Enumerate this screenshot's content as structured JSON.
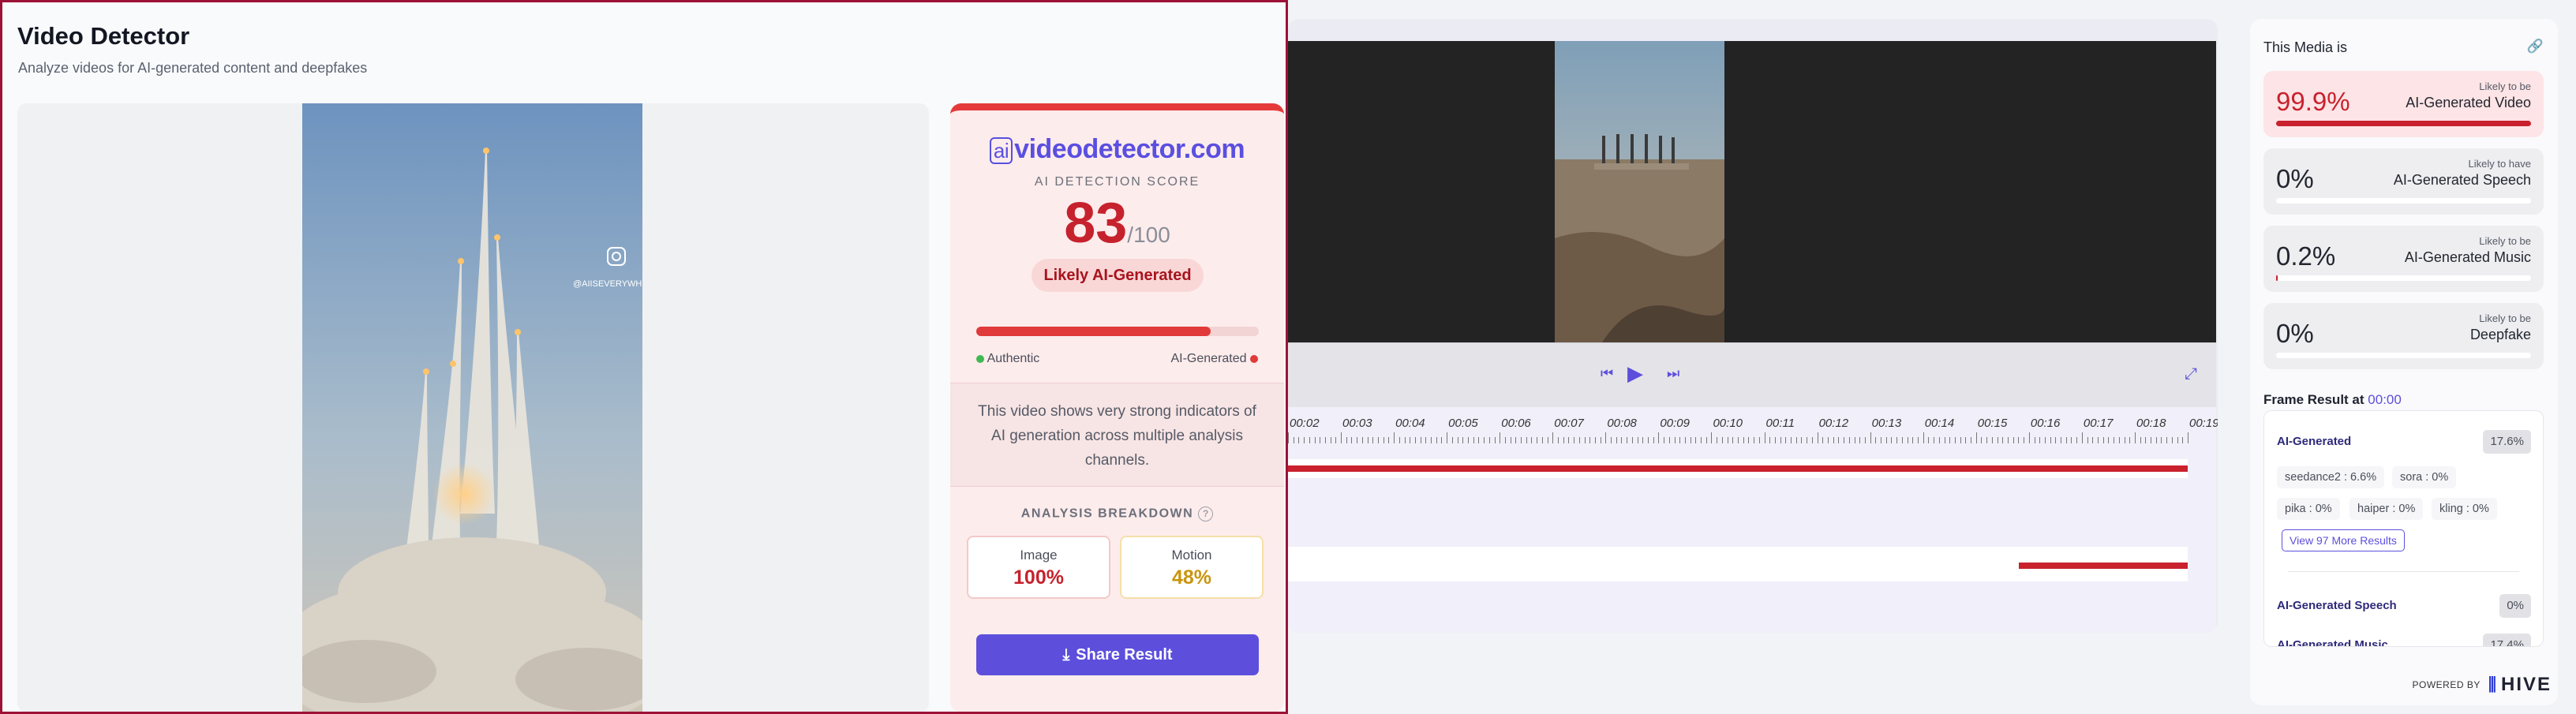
{
  "left_panel": {
    "title": "Video Detector",
    "subtitle": "Analyze videos for AI-generated content and deepfakes",
    "video_watermark": "@AIISEVERYWHERE",
    "card": {
      "logo_prefix": "ai",
      "logo_text": "videodetector.com",
      "score_label": "AI DETECTION SCORE",
      "score": 83,
      "score_display": "83",
      "score_max_display": "/100",
      "verdict": "Likely AI-Generated",
      "bar_fraction": 0.83,
      "bar_left_label": "Authentic",
      "bar_right_label": "AI-Generated",
      "description": "This video shows very strong indicators of AI generation across multiple analysis channels.",
      "breakdown_label": "ANALYSIS BREAKDOWN",
      "breakdown_help": "?",
      "metrics": [
        {
          "label": "Image",
          "value": "100%"
        },
        {
          "label": "Motion",
          "value": "48%"
        }
      ],
      "share_label": "Share Result"
    },
    "colors": {
      "accent": "#5d4fdc",
      "danger": "#c6222d",
      "warning": "#c9950f",
      "border": "#9c1237"
    }
  },
  "timeline": {
    "ticks": [
      "00:02",
      "00:03",
      "00:04",
      "00:05",
      "00:06",
      "00:07",
      "00:08",
      "00:09",
      "00:10",
      "00:11",
      "00:12",
      "00:13",
      "00:14",
      "00:15",
      "00:16",
      "00:17",
      "00:18",
      "00:19"
    ]
  },
  "right_panel": {
    "header": "This Media is",
    "cards": [
      {
        "percent": "99.9%",
        "small": "Likely to be",
        "large": "AI-Generated Video",
        "fraction": 0.999
      },
      {
        "percent": "0%",
        "small": "Likely to have",
        "large": "AI-Generated Speech",
        "fraction": 0
      },
      {
        "percent": "0.2%",
        "small": "Likely to be",
        "large": "AI-Generated Music",
        "fraction": 0.002
      },
      {
        "percent": "0%",
        "small": "Likely to be",
        "large": "Deepfake",
        "fraction": 0
      }
    ],
    "frame_result_label": "Frame Result at",
    "frame_time": "00:00",
    "frame": {
      "ai_generated_label": "AI-Generated",
      "ai_generated_value": "17.6%",
      "models": [
        {
          "name": "seedance2 :",
          "value": "6.6%"
        },
        {
          "name": "sora :",
          "value": "0%"
        },
        {
          "name": "pika :",
          "value": "0%"
        },
        {
          "name": "haiper :",
          "value": "0%"
        },
        {
          "name": "kling :",
          "value": "0%"
        }
      ],
      "more_results": "View 97 More Results",
      "speech_label": "AI-Generated Speech",
      "speech_value": "0%",
      "music_label": "AI-Generated Music",
      "music_value": "17.4%"
    },
    "powered_by": "POWERED BY",
    "brand": "HIVE"
  }
}
